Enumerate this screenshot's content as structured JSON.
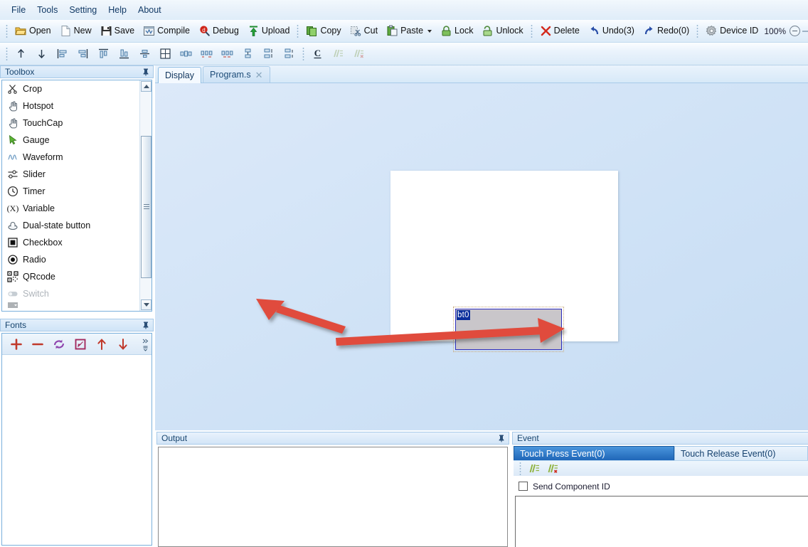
{
  "menubar": {
    "items": [
      {
        "label": "File",
        "name": "menu-file"
      },
      {
        "label": "Tools",
        "name": "menu-tools"
      },
      {
        "label": "Setting",
        "name": "menu-setting"
      },
      {
        "label": "Help",
        "name": "menu-help"
      },
      {
        "label": "About",
        "name": "menu-about"
      }
    ]
  },
  "toolbar": {
    "file_group": [
      {
        "label": "Open",
        "icon": "open-folder-icon"
      },
      {
        "label": "New",
        "icon": "new-page-icon"
      },
      {
        "label": "Save",
        "icon": "save-floppy-icon"
      },
      {
        "label": "Compile",
        "icon": "compile-icon"
      },
      {
        "label": "Debug",
        "icon": "debug-icon"
      },
      {
        "label": "Upload",
        "icon": "upload-arrow-icon"
      }
    ],
    "edit_group": [
      {
        "label": "Copy",
        "icon": "copy-icon"
      },
      {
        "label": "Cut",
        "icon": "cut-icon"
      },
      {
        "label": "Paste",
        "icon": "paste-icon",
        "dropdown": true
      },
      {
        "label": "Lock",
        "icon": "lock-closed-icon"
      },
      {
        "label": "Unlock",
        "icon": "lock-open-icon"
      }
    ],
    "history_group": [
      {
        "label": "Delete",
        "icon": "delete-x-icon"
      },
      {
        "label": "Undo(3)",
        "icon": "undo-icon"
      },
      {
        "label": "Redo(0)",
        "icon": "redo-icon"
      }
    ],
    "device": {
      "icon": "gear-icon",
      "label": "Device ID",
      "zoom_level": "100%"
    }
  },
  "align_toolbar": {
    "items": [
      {
        "name": "move-up-icon",
        "title": "Move up"
      },
      {
        "name": "move-down-icon",
        "title": "Move down"
      },
      {
        "name": "align-left-icon",
        "title": "Align left"
      },
      {
        "name": "align-right-icon",
        "title": "Align right"
      },
      {
        "name": "align-top-icon",
        "title": "Align top"
      },
      {
        "name": "align-bottom-icon",
        "title": "Align bottom"
      },
      {
        "name": "align-center-vertical-icon",
        "title": "Center vertically"
      },
      {
        "name": "align-center-horizontal-icon",
        "title": "Center horizontally"
      },
      {
        "name": "center-in-page-icon",
        "title": "Center in page"
      },
      {
        "name": "same-size-icon",
        "title": "Same size"
      },
      {
        "name": "same-width-icon",
        "title": "Same width"
      },
      {
        "name": "same-height-icon",
        "title": "Same height"
      },
      {
        "name": "distribute-horizontal-icon",
        "title": "Distribute horizontally"
      },
      {
        "name": "distribute-vertical-icon",
        "title": "Distribute vertically"
      },
      {
        "name": "spacing-equal-icon",
        "title": "Equal spacing"
      }
    ],
    "text_group": [
      {
        "name": "bold-c-icon",
        "label": "C",
        "disabled": false
      },
      {
        "name": "comment-lines-icon",
        "label": "",
        "disabled": true
      },
      {
        "name": "uncomment-lines-icon",
        "label": "",
        "disabled": true
      }
    ]
  },
  "toolbox": {
    "title": "Toolbox",
    "pin_icon": "pin-icon",
    "items": [
      {
        "label": "Crop",
        "icon": "crop-scissors-icon",
        "disabled": false
      },
      {
        "label": "Hotspot",
        "icon": "hand-pointer-icon",
        "disabled": false
      },
      {
        "label": "TouchCap",
        "icon": "hand-touch-icon",
        "disabled": false
      },
      {
        "label": "Gauge",
        "icon": "gauge-pointer-icon",
        "disabled": false
      },
      {
        "label": "Waveform",
        "icon": "waveform-icon",
        "disabled": false
      },
      {
        "label": "Slider",
        "icon": "slider-icon",
        "disabled": false
      },
      {
        "label": "Timer",
        "icon": "clock-icon",
        "disabled": false
      },
      {
        "label": "Variable",
        "icon": "variable-x-icon",
        "disabled": false
      },
      {
        "label": "Dual-state button",
        "icon": "dual-state-button-icon",
        "disabled": false
      },
      {
        "label": "Checkbox",
        "icon": "checkbox-icon",
        "disabled": false
      },
      {
        "label": "Radio",
        "icon": "radio-icon",
        "disabled": false
      },
      {
        "label": "QRcode",
        "icon": "qrcode-icon",
        "disabled": false
      },
      {
        "label": "Switch",
        "icon": "switch-toggle-icon",
        "disabled": true
      }
    ]
  },
  "fonts": {
    "title": "Fonts",
    "pin_icon": "pin-icon",
    "tools": [
      {
        "name": "add-font-icon",
        "glyph": "+"
      },
      {
        "name": "remove-font-icon",
        "glyph": "−"
      },
      {
        "name": "refresh-font-icon",
        "glyph": "refresh"
      },
      {
        "name": "edit-font-icon",
        "glyph": "edit"
      },
      {
        "name": "move-font-up-icon",
        "glyph": "↑"
      },
      {
        "name": "move-font-down-icon",
        "glyph": "↓"
      }
    ]
  },
  "tabs": [
    {
      "label": "Display",
      "active": true,
      "closable": false
    },
    {
      "label": "Program.s",
      "active": false,
      "closable": true,
      "close_glyph": "✕"
    }
  ],
  "canvas": {
    "component": {
      "id_label": "bt0",
      "type": "dual-state-button",
      "fill_color": "#c9c6ca",
      "border_color": "#2f2fbe"
    }
  },
  "annotations": {
    "arrow_color": "#e04b3c",
    "arrows": [
      {
        "name": "arrow-to-toolbox",
        "direction": "left"
      },
      {
        "name": "arrow-to-canvas",
        "direction": "right"
      }
    ]
  },
  "output": {
    "title": "Output",
    "pin_icon": "pin-icon",
    "content": ""
  },
  "event": {
    "title": "Event",
    "tabs": [
      {
        "label": "Touch Press Event(0)",
        "active": true
      },
      {
        "label": "Touch Release Event(0)",
        "active": false
      }
    ],
    "tools": [
      {
        "name": "comment-code-icon"
      },
      {
        "name": "uncomment-code-icon"
      }
    ],
    "checkbox": {
      "label": "Send Component ID",
      "checked": false
    },
    "code": ""
  }
}
